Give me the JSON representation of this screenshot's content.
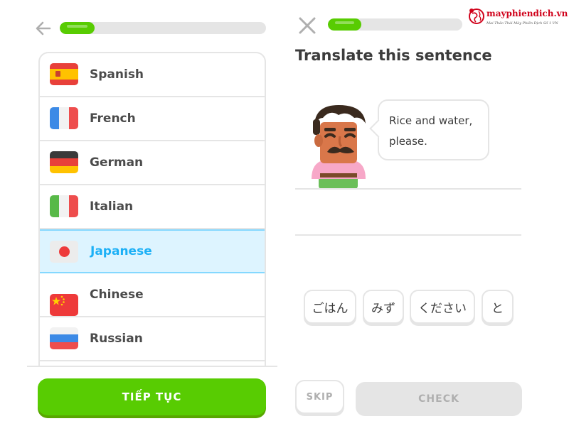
{
  "left_panel": {
    "back_icon": "arrow-left-icon",
    "progress": 0.17,
    "languages": [
      {
        "label": "Spanish",
        "flag": "spain-flag-icon",
        "selected": false
      },
      {
        "label": "French",
        "flag": "france-flag-icon",
        "selected": false
      },
      {
        "label": "German",
        "flag": "germany-flag-icon",
        "selected": false
      },
      {
        "label": "Italian",
        "flag": "italy-flag-icon",
        "selected": false
      },
      {
        "label": "Japanese",
        "flag": "japan-flag-icon",
        "selected": true
      },
      {
        "label": "Chinese",
        "flag": "china-flag-icon",
        "selected": false
      },
      {
        "label": "Russian",
        "flag": "russia-flag-icon",
        "selected": false
      }
    ],
    "continue_label": "TIẾP TỤC"
  },
  "right_panel": {
    "close_icon": "close-icon",
    "progress": 0.25,
    "heading": "Translate this sentence",
    "speech_bubble": {
      "line1": "Rice and water,",
      "line2": "please."
    },
    "word_bank": [
      "ごはん",
      "みず",
      "ください",
      "と"
    ],
    "skip_label": "SKIP",
    "check_label": "CHECK"
  },
  "watermark": {
    "name": "mayphiendich.vn",
    "tagline": "Mai Thảo Thái Máy Phiên Dịch Số 1 VN"
  },
  "colors": {
    "accent_green": "#58cc02",
    "accent_green_shadow": "#58a700",
    "selected_bg": "#ddf4ff",
    "selected_border": "#84d8ff",
    "selected_text": "#1cb0f6",
    "border_gray": "#e5e5e5",
    "disabled_text": "#afafaf",
    "watermark_red": "#d0021b"
  }
}
